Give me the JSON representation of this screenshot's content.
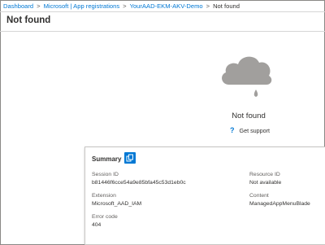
{
  "breadcrumb": {
    "items": [
      "Dashboard",
      "Microsoft | App registrations",
      "YourAAD-EKM-AKV-Demo"
    ],
    "current": "Not found",
    "separator": ">"
  },
  "page": {
    "title": "Not found"
  },
  "error": {
    "message": "Not found",
    "support_icon": "?",
    "support_label": "Get support"
  },
  "summary": {
    "title": "Summary",
    "fields": {
      "session_id": {
        "label": "Session ID",
        "value": "b81446f6cce54a9e85bfa45c53d1eb0c"
      },
      "extension": {
        "label": "Extension",
        "value": "Microsoft_AAD_IAM"
      },
      "error_code": {
        "label": "Error code",
        "value": "404"
      },
      "resource_id": {
        "label": "Resource ID",
        "value": "Not available"
      },
      "content": {
        "label": "Content",
        "value": "ManagedAppMenuBlade"
      }
    }
  },
  "icons": {
    "cloud": "cloud-rain-icon",
    "copy": "copy-icon",
    "help": "help-icon"
  },
  "colors": {
    "link": "#0078d4",
    "cloud": "#a19f9d",
    "text": "#323130",
    "muted": "#605e5c"
  }
}
